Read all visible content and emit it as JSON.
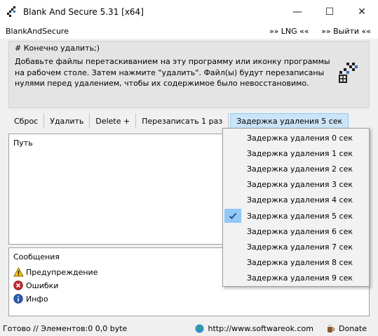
{
  "window": {
    "title": "Blank And Secure 5.31 [x64]",
    "minimize": "—",
    "maximize": "☐",
    "close": "✕"
  },
  "menu": {
    "app": "BlankAndSecure",
    "lng": "»» LNG ««",
    "exit": "»» Выйти ««"
  },
  "info": {
    "title": "# Конечно удалить;)",
    "text": "Добавьте файлы перетаскиванием на эту программу или иконку программы на рабочем столе. Затем нажмите \"удалить\". Файл(ы) будут перезаписаны нулями перед удалением, чтобы их содержимое было невосстановимо."
  },
  "toolbar": {
    "reset": "Сброс",
    "delete": "Удалить",
    "delete_plus": "Delete +",
    "overwrite": "Перезаписать 1 раз",
    "delay": "Задержка удаления 5 сек"
  },
  "list": {
    "header": "Путь"
  },
  "messages": {
    "title": "Сообщения",
    "warning": "Предупреждение",
    "errors": "Ошибки",
    "info": "Инфо"
  },
  "status": {
    "text": "Готово // Элементов:0 0,0 byte",
    "link": "http://www.softwareok.com",
    "donate": "Donate"
  },
  "dropdown": {
    "selected": "Задержка удаления 5 сек",
    "items": [
      "Задержка удаления 0 сек",
      "Задержка удаления 1 сек",
      "Задержка удаления 2 сек",
      "Задержка удаления 3 сек",
      "Задержка удаления 4 сек",
      "Задержка удаления 5 сек",
      "Задержка удаления 6 сек",
      "Задержка удаления 7 сек",
      "Задержка удаления 8 сек",
      "Задержка удаления 9 сек"
    ]
  }
}
